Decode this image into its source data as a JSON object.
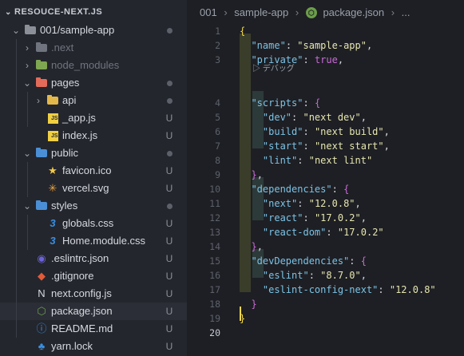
{
  "sidebar": {
    "title": "RESOUCE-NEXT.JS",
    "rows": [
      {
        "label": "001/sample-app",
        "icon": "open-folder-icon",
        "twisty": "⌄",
        "status": "dot"
      },
      {
        "label": ".next",
        "icon": "folder-icon",
        "twisty": "›",
        "status": "",
        "dim": true
      },
      {
        "label": "node_modules",
        "icon": "node-modules-folder-icon",
        "twisty": "›",
        "status": "",
        "dim": true
      },
      {
        "label": "pages",
        "icon": "pages-folder-icon",
        "twisty": "⌄",
        "status": "dot"
      },
      {
        "label": "api",
        "icon": "api-folder-icon",
        "twisty": "›",
        "status": "dot"
      },
      {
        "label": "_app.js",
        "icon": "javascript-file-icon",
        "status": "U"
      },
      {
        "label": "index.js",
        "icon": "javascript-file-icon",
        "status": "U"
      },
      {
        "label": "public",
        "icon": "public-folder-icon",
        "twisty": "⌄",
        "status": "dot"
      },
      {
        "label": "favicon.ico",
        "icon": "star-icon",
        "status": "U"
      },
      {
        "label": "vercel.svg",
        "icon": "svg-file-icon",
        "status": "U"
      },
      {
        "label": "styles",
        "icon": "styles-folder-icon",
        "twisty": "⌄",
        "status": "dot"
      },
      {
        "label": "globals.css",
        "icon": "css-file-icon",
        "status": "U"
      },
      {
        "label": "Home.module.css",
        "icon": "css-file-icon",
        "status": "U"
      },
      {
        "label": ".eslintrc.json",
        "icon": "eslint-file-icon",
        "status": "U"
      },
      {
        "label": ".gitignore",
        "icon": "git-file-icon",
        "status": "U"
      },
      {
        "label": "next.config.js",
        "icon": "next-file-icon",
        "status": "U"
      },
      {
        "label": "package.json",
        "icon": "node-package-icon",
        "status": "U",
        "selected": true
      },
      {
        "label": "README.md",
        "icon": "info-file-icon",
        "status": "U"
      },
      {
        "label": "yarn.lock",
        "icon": "yarn-file-icon",
        "status": "U"
      }
    ]
  },
  "breadcrumb": {
    "parts": [
      "001",
      "sample-app",
      "package.json",
      "..."
    ]
  },
  "editor": {
    "line_numbers": [
      "1",
      "2",
      "3",
      "4",
      "5",
      "6",
      "7",
      "8",
      "9",
      "10",
      "11",
      "12",
      "13",
      "14",
      "15",
      "16",
      "17",
      "18",
      "19",
      "20"
    ],
    "active_line": "20",
    "codelens": "▷ デバッグ",
    "lines": [
      [
        {
          "t": "{",
          "c": "br1"
        }
      ],
      [
        {
          "t": "  "
        },
        {
          "t": "\"name\"",
          "c": "k"
        },
        {
          "t": ": "
        },
        {
          "t": "\"sample-app\"",
          "c": "s"
        },
        {
          "t": ","
        }
      ],
      [
        {
          "t": "  "
        },
        {
          "t": "\"private\"",
          "c": "k"
        },
        {
          "t": ": "
        },
        {
          "t": "true",
          "c": "b"
        },
        {
          "t": ","
        }
      ],
      [
        {
          "t": "  "
        },
        {
          "t": "\"scripts\"",
          "c": "k"
        },
        {
          "t": ": "
        },
        {
          "t": "{",
          "c": "br2"
        }
      ],
      [
        {
          "t": "    "
        },
        {
          "t": "\"dev\"",
          "c": "k"
        },
        {
          "t": ": "
        },
        {
          "t": "\"next dev\"",
          "c": "s"
        },
        {
          "t": ","
        }
      ],
      [
        {
          "t": "    "
        },
        {
          "t": "\"build\"",
          "c": "k"
        },
        {
          "t": ": "
        },
        {
          "t": "\"next build\"",
          "c": "s"
        },
        {
          "t": ","
        }
      ],
      [
        {
          "t": "    "
        },
        {
          "t": "\"start\"",
          "c": "k"
        },
        {
          "t": ": "
        },
        {
          "t": "\"next start\"",
          "c": "s"
        },
        {
          "t": ","
        }
      ],
      [
        {
          "t": "    "
        },
        {
          "t": "\"lint\"",
          "c": "k"
        },
        {
          "t": ": "
        },
        {
          "t": "\"next lint\"",
          "c": "s"
        }
      ],
      [
        {
          "t": "  "
        },
        {
          "t": "}",
          "c": "br2"
        },
        {
          "t": ","
        }
      ],
      [
        {
          "t": "  "
        },
        {
          "t": "\"dependencies\"",
          "c": "k"
        },
        {
          "t": ": "
        },
        {
          "t": "{",
          "c": "br2"
        }
      ],
      [
        {
          "t": "    "
        },
        {
          "t": "\"next\"",
          "c": "k"
        },
        {
          "t": ": "
        },
        {
          "t": "\"12.0.8\"",
          "c": "s"
        },
        {
          "t": ","
        }
      ],
      [
        {
          "t": "    "
        },
        {
          "t": "\"react\"",
          "c": "k"
        },
        {
          "t": ": "
        },
        {
          "t": "\"17.0.2\"",
          "c": "s"
        },
        {
          "t": ","
        }
      ],
      [
        {
          "t": "    "
        },
        {
          "t": "\"react-dom\"",
          "c": "k"
        },
        {
          "t": ": "
        },
        {
          "t": "\"17.0.2\"",
          "c": "s"
        }
      ],
      [
        {
          "t": "  "
        },
        {
          "t": "}",
          "c": "br2"
        },
        {
          "t": ","
        }
      ],
      [
        {
          "t": "  "
        },
        {
          "t": "\"devDependencies\"",
          "c": "k"
        },
        {
          "t": ": "
        },
        {
          "t": "{",
          "c": "br2"
        }
      ],
      [
        {
          "t": "    "
        },
        {
          "t": "\"eslint\"",
          "c": "k"
        },
        {
          "t": ": "
        },
        {
          "t": "\"8.7.0\"",
          "c": "s"
        },
        {
          "t": ","
        }
      ],
      [
        {
          "t": "    "
        },
        {
          "t": "\"eslint-config-next\"",
          "c": "k"
        },
        {
          "t": ": "
        },
        {
          "t": "\"12.0.8\"",
          "c": "s"
        }
      ],
      [
        {
          "t": "  "
        },
        {
          "t": "}",
          "c": "br2"
        }
      ],
      [
        {
          "t": "}",
          "c": "br1"
        }
      ],
      []
    ]
  },
  "colors": {
    "json_key": "#7cc3e6",
    "json_string": "#e6e6b0",
    "json_boolean": "#c86ad6",
    "bracket_outer": "#f2d74b",
    "bracket_inner": "#c86ad6"
  }
}
